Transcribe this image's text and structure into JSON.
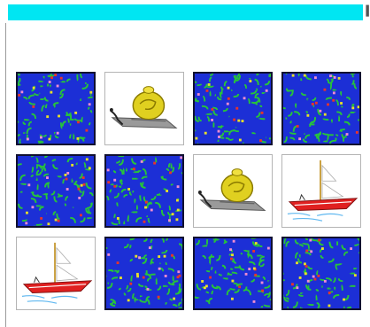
{
  "colors": {
    "header_bar": "#00e6f2",
    "card_back": "#1c2fd6",
    "card_back_pattern": "#27c43a"
  },
  "grid": {
    "rows": 3,
    "cols": 4
  },
  "cards": [
    {
      "state": "face-down",
      "image": null
    },
    {
      "state": "face-up",
      "image": "snail"
    },
    {
      "state": "face-down",
      "image": null
    },
    {
      "state": "face-down",
      "image": null
    },
    {
      "state": "face-down",
      "image": null
    },
    {
      "state": "face-down",
      "image": null
    },
    {
      "state": "face-up",
      "image": "snail"
    },
    {
      "state": "face-up",
      "image": "sailboat"
    },
    {
      "state": "face-up",
      "image": "sailboat"
    },
    {
      "state": "face-down",
      "image": null
    },
    {
      "state": "face-down",
      "image": null
    },
    {
      "state": "face-down",
      "image": null
    }
  ]
}
